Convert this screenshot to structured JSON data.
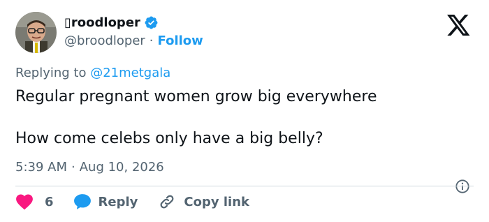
{
  "author": {
    "display_name": "▯roodloper",
    "handle": "@broodloper",
    "separator": "·",
    "follow_label": "Follow"
  },
  "reply_context": {
    "prefix": "Replying to",
    "mention": "@21metgala"
  },
  "tweet": {
    "line1": "Regular pregnant women grow big everywhere",
    "line2": "How come celebs only have a big belly?"
  },
  "meta": {
    "time": "5:39 AM",
    "separator": "·",
    "date": "Aug 10, 2026"
  },
  "actions": {
    "like_count": "6",
    "reply_label": "Reply",
    "copy_link_label": "Copy link"
  },
  "colors": {
    "accent": "#1d9bf0",
    "like": "#f91880",
    "muted": "#536471",
    "text": "#0f1419"
  },
  "icons": [
    "verified-badge-icon",
    "x-logo-icon",
    "heart-icon",
    "reply-bubble-icon",
    "link-icon",
    "info-icon"
  ]
}
